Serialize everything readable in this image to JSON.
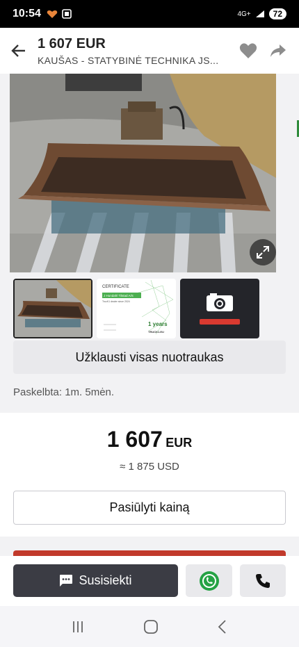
{
  "status": {
    "time": "10:54",
    "network": "4G+",
    "battery": "72"
  },
  "header": {
    "title": "1 607 EUR",
    "subtitle": "KAUŠAS - STATYBINĖ TECHNIKA  JS..."
  },
  "thumbnails": {
    "certificate_title": "CERTIFICATE",
    "certificate_company": "J Hundahl Tilstad A/S",
    "certificate_line": "TrucK1 dealer since 2024",
    "certificate_years": "1 years",
    "certificate_brand": "TRUCK1.EU"
  },
  "buttons": {
    "all_photos": "Užklausti visas nuotraukas",
    "offer_price": "Pasiūlyti kainą",
    "contact": "Susisiekti"
  },
  "posted": "Paskelbta: 1m. 5mėn.",
  "price": {
    "value": "1 607",
    "currency": "EUR",
    "converted": "≈ 1 875 USD"
  },
  "colors": {
    "accent_red": "#c1392b",
    "contact_bg": "#3b3c44",
    "whatsapp": "#25a244"
  }
}
